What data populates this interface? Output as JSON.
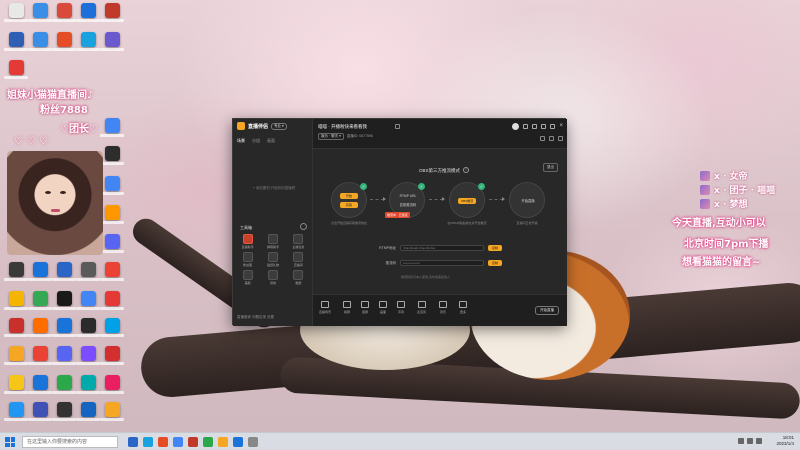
{
  "desktop": {
    "icon_colors": [
      "#e8e8e8",
      "#3a8ee6",
      "#d94a3a",
      "#1e6fd9",
      "#c0392b",
      "#2f5fb5",
      "#3a8ee6",
      "#e44d26",
      "#1aa1e0",
      "#6a5acd",
      "#e53935",
      "#4285f4",
      "#2d2d2d",
      "#4285f4",
      "#ff9800",
      "#5865f2",
      "#3a3a3a",
      "#1a73d9",
      "#2b65c6",
      "#5a5a5a",
      "#ea4335",
      "#f4b400",
      "#34a853",
      "#1a1a1a",
      "#4285f4",
      "#e53935",
      "#c9302c",
      "#ff6d00",
      "#1a73d9",
      "#2b2b2b",
      "#00a1e6",
      "#f5a623",
      "#ea4335",
      "#5865f2",
      "#7c4dff",
      "#d32f2f",
      "#f5c518",
      "#1a73d9",
      "#2aa84a",
      "#0aa",
      "#e91e63",
      "#2196f3",
      "#3f51b5",
      "#333",
      "#1565c0",
      "#f5a623",
      "#1a73d9",
      "#ff7043",
      "#666",
      "#7cb342",
      "#e53935",
      "#ffb300",
      "#2196f3",
      "#26c6da",
      "#00bcd4",
      "#ec407a",
      "#8d6e63",
      "#d7ccc8"
    ]
  },
  "overlay_left": {
    "line1": "姐妹小猫猫直播间♪",
    "line2": "粉丝7888",
    "line3": "♡团长♡",
    "line4": "♡ ♡ ♡"
  },
  "overlay_right": {
    "chat": [
      {
        "name": "x  ·  女帝"
      },
      {
        "name": "x  ·  团子  ·  喵喵"
      },
      {
        "name": "x  ·  梦想"
      }
    ],
    "messages": [
      "今天直播,互动小可以",
      "北京时间7pm下播",
      "想看猫猫的留言~"
    ]
  },
  "app": {
    "name": "直播伴侣",
    "version": "专业 ▾",
    "left_tabs": [
      "场景",
      "分组",
      "画面"
    ],
    "scene_hint": "+ 添加素材 开始你的直播吧",
    "tools_title": "工具箱",
    "tools": [
      {
        "label": "直播助手",
        "hot": true
      },
      {
        "label": "弹幕助手",
        "hot": false
      },
      {
        "label": "主播任务",
        "hot": false
      },
      {
        "label": "粉丝团",
        "hot": false
      },
      {
        "label": "贴纸礼物",
        "hot": false
      },
      {
        "label": "直播间",
        "hot": false
      },
      {
        "label": "美颜",
        "hot": false
      },
      {
        "label": "音效",
        "hot": false
      },
      {
        "label": "数据",
        "hot": false
      }
    ],
    "left_bottom": "直播管家  问题反馈  设置",
    "stream_title": "喵喵 · 开播啦快来看看我",
    "category_chip": "娱乐 · 聊天 ▾",
    "meta_text": "直播ID: 0677596",
    "mode_title": "OBS第三方推流模式",
    "mode_q": "?",
    "exit_label": "退出",
    "steps": [
      {
        "pill1": "开始",
        "pill2": "获取",
        "desc": "点击开始直播获取推流地址"
      },
      {
        "text1": "RTMP URL",
        "text2": "复制推流码",
        "desc": "复制地址"
      },
      {
        "pill1": "OBS推流",
        "desc": "在OBS中粘贴地址并开始推流"
      },
      {
        "text1": "开始直播",
        "desc": "直播间正常开播"
      }
    ],
    "red_tag": "推流中 · 已连接",
    "rows": [
      {
        "label": "RTMP地址",
        "value": "rtmp://push-rtmp-l11.live",
        "button": "复制"
      },
      {
        "label": "推流码",
        "value": "••••••••••••••••",
        "button": "复制"
      }
    ],
    "note": "推流码仅可本人使用,请勿泄露给他人",
    "bottom": [
      "直播场景",
      "横屏",
      "竖屏",
      "画面",
      "声音",
      "麦克风",
      "音乐",
      "更多"
    ],
    "live_button": "开始直播"
  },
  "taskbar": {
    "search_placeholder": "在这里输入你要搜索的内容",
    "app_colors": [
      "#2b65c6",
      "#1aa1e0",
      "#e44d26",
      "#4285f4",
      "#c0392b",
      "#2aa84a",
      "#f5a623",
      "#1a73d9",
      "#888"
    ],
    "time": "18:01",
    "date": "2023/1/4"
  }
}
